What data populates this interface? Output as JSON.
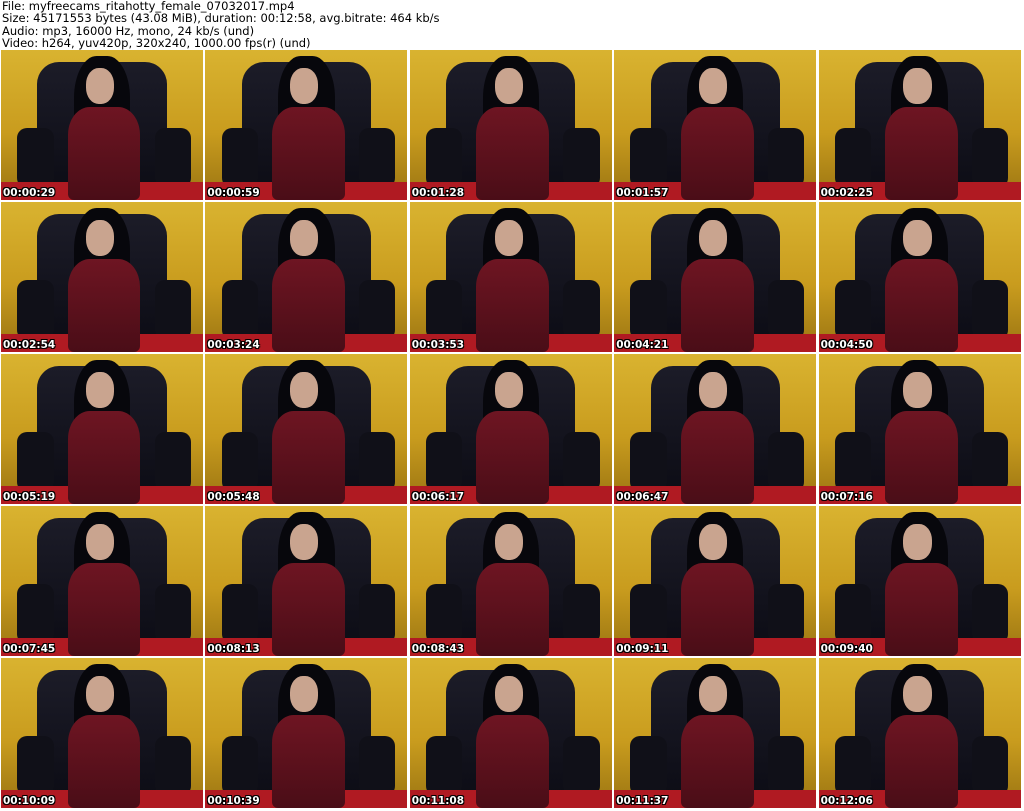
{
  "header": {
    "file_line": "File: myfreecams_ritahotty_female_07032017.mp4",
    "size_line": "Size: 45171553 bytes (43.08 MiB), duration: 00:12:58, avg.bitrate: 464 kb/s",
    "audio_line": "Audio: mp3, 16000 Hz, mono, 24 kb/s (und)",
    "video_line": "Video: h264, yuv420p, 320x240, 1000.00 fps(r) (und)"
  },
  "thumbnails": [
    {
      "timestamp": "00:00:29"
    },
    {
      "timestamp": "00:00:59"
    },
    {
      "timestamp": "00:01:28"
    },
    {
      "timestamp": "00:01:57"
    },
    {
      "timestamp": "00:02:25"
    },
    {
      "timestamp": "00:02:54"
    },
    {
      "timestamp": "00:03:24"
    },
    {
      "timestamp": "00:03:53"
    },
    {
      "timestamp": "00:04:21"
    },
    {
      "timestamp": "00:04:50"
    },
    {
      "timestamp": "00:05:19"
    },
    {
      "timestamp": "00:05:48"
    },
    {
      "timestamp": "00:06:17"
    },
    {
      "timestamp": "00:06:47"
    },
    {
      "timestamp": "00:07:16"
    },
    {
      "timestamp": "00:07:45"
    },
    {
      "timestamp": "00:08:13"
    },
    {
      "timestamp": "00:08:43"
    },
    {
      "timestamp": "00:09:11"
    },
    {
      "timestamp": "00:09:40"
    },
    {
      "timestamp": "00:10:09"
    },
    {
      "timestamp": "00:10:39"
    },
    {
      "timestamp": "00:11:08"
    },
    {
      "timestamp": "00:11:37"
    },
    {
      "timestamp": "00:12:06"
    }
  ]
}
